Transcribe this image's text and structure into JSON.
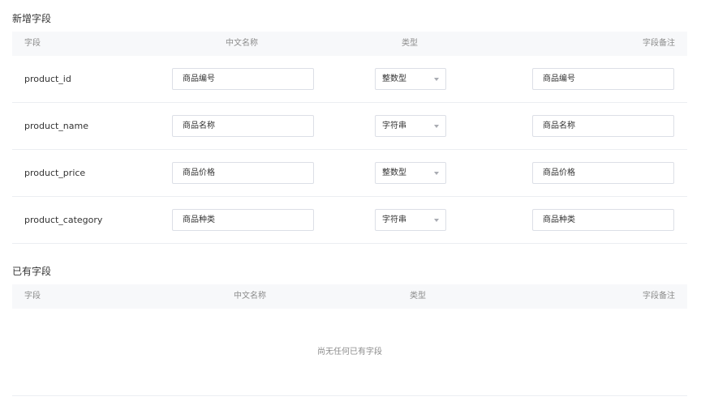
{
  "new_fields": {
    "title": "新增字段",
    "headers": {
      "field": "字段",
      "cn_name": "中文名称",
      "type": "类型",
      "remark": "字段备注"
    },
    "rows": [
      {
        "field": "product_id",
        "cn_name": "商品编号",
        "type": "整数型",
        "remark": "商品编号"
      },
      {
        "field": "product_name",
        "cn_name": "商品名称",
        "type": "字符串",
        "remark": "商品名称"
      },
      {
        "field": "product_price",
        "cn_name": "商品价格",
        "type": "整数型",
        "remark": "商品价格"
      },
      {
        "field": "product_category",
        "cn_name": "商品种类",
        "type": "字符串",
        "remark": "商品种类"
      }
    ]
  },
  "existing_fields": {
    "title": "已有字段",
    "headers": {
      "field": "字段",
      "cn_name": "中文名称",
      "type": "类型",
      "remark": "字段备注"
    },
    "empty_text": "尚无任何已有字段"
  }
}
